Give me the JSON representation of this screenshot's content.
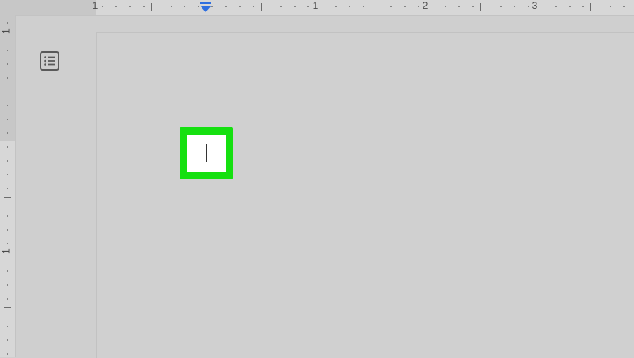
{
  "ruler": {
    "horizontal_labels": [
      "1",
      "1",
      "2",
      "3"
    ],
    "vertical_labels": [
      "1",
      "1"
    ]
  },
  "icons": {
    "outline": "document-outline-icon",
    "indent_marker": "first-line-indent-marker",
    "cursor": "text-cursor"
  },
  "colors": {
    "highlight": "#15e010",
    "indent_marker": "#2f6fe0"
  }
}
